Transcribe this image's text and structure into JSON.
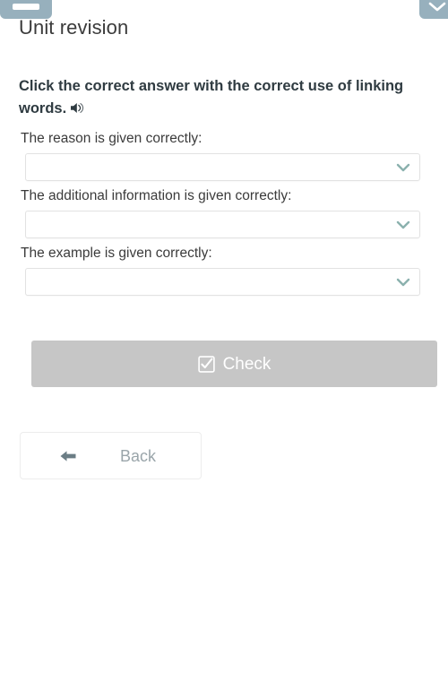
{
  "window": {
    "top_left_button": {
      "name": "menu-bar-button",
      "icon": "horizontal-bar-icon"
    },
    "top_right_button": {
      "name": "collapse-button",
      "icon": "chevron-down-icon"
    },
    "chrome_color": "#97b0bd"
  },
  "header": {
    "title": "Unit revision"
  },
  "instruction": {
    "text": "Click the correct answer with the correct use of linking words.",
    "audio_icon": "speaker-icon"
  },
  "questions": [
    {
      "label": "The reason is given correctly:",
      "selected_value": "",
      "chevron_icon": "chevron-down-icon"
    },
    {
      "label": "The additional information is given correctly:",
      "selected_value": "",
      "chevron_icon": "chevron-down-icon"
    },
    {
      "label": "The example is given correctly:",
      "selected_value": "",
      "chevron_icon": "chevron-down-icon"
    }
  ],
  "actions": {
    "check_label": "Check",
    "check_icon": "checkbox-checked-icon",
    "check_color": "#c6c6c6",
    "back_label": "Back",
    "back_icon": "arrow-left-icon",
    "back_text_color": "#9aa5aa"
  },
  "colors": {
    "accent_chevron": "#8bb1ae",
    "title_text": "#3b3b3b",
    "body_text": "#2f3b41",
    "border": "#e2e2e2",
    "background": "#ffffff"
  }
}
